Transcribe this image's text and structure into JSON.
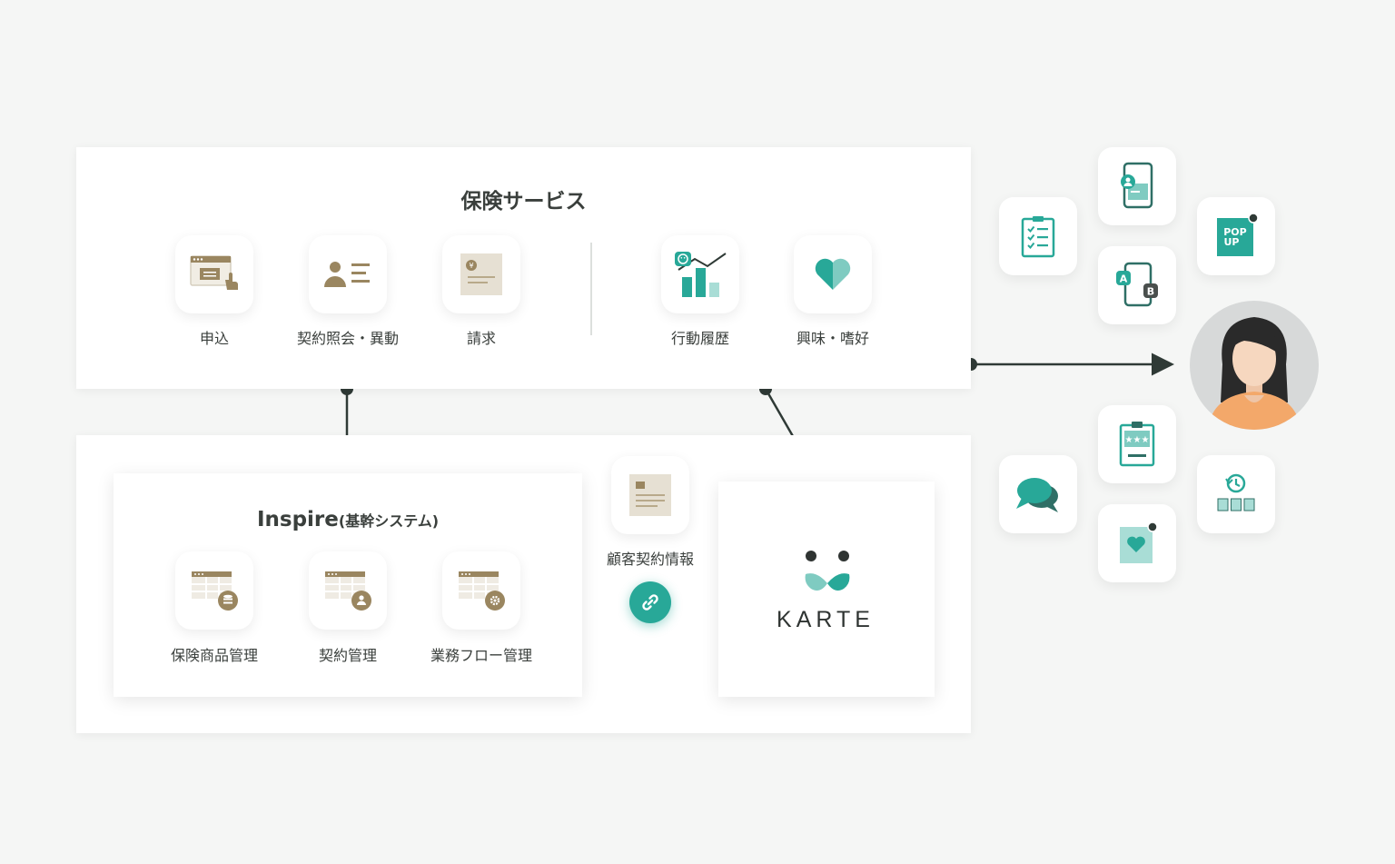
{
  "insurance_service": {
    "title": "保険サービス",
    "items": [
      {
        "label": "申込",
        "icon": "application-form-icon"
      },
      {
        "label": "契約照会・異動",
        "icon": "contract-inquiry-icon"
      },
      {
        "label": "請求",
        "icon": "billing-invoice-icon"
      },
      {
        "label": "行動履歴",
        "icon": "behavior-history-chart-icon"
      },
      {
        "label": "興味・嗜好",
        "icon": "interest-heart-icon"
      }
    ]
  },
  "inspire": {
    "title": "Inspire",
    "subtitle": "(基幹システム)",
    "items": [
      {
        "label": "保険商品管理",
        "icon": "product-management-icon"
      },
      {
        "label": "契約管理",
        "icon": "contract-management-icon"
      },
      {
        "label": "業務フロー管理",
        "icon": "workflow-management-icon"
      }
    ]
  },
  "customer_contract_info": {
    "label": "顧客契約情報",
    "icon": "customer-document-icon"
  },
  "link_icon": "link-chain-icon",
  "karte": {
    "logo_text": "KARTE"
  },
  "channels": [
    {
      "icon": "checklist-clipboard-icon",
      "text": ""
    },
    {
      "icon": "mobile-profile-icon",
      "text": ""
    },
    {
      "icon": "ab-test-mobile-icon",
      "text_a": "A",
      "text_b": "B"
    },
    {
      "icon": "popup-icon",
      "text_1": "POP",
      "text_2": "UP"
    },
    {
      "icon": "chat-bubbles-icon",
      "text": ""
    },
    {
      "icon": "rating-card-icon",
      "text": ""
    },
    {
      "icon": "favorite-notification-icon",
      "text": ""
    },
    {
      "icon": "history-recommend-icon",
      "text": ""
    }
  ],
  "colors": {
    "teal": "#28a898",
    "teal_light": "#7fcbc1",
    "brown": "#9a8660",
    "beige": "#e6e0d3",
    "line": "#2f3a36",
    "skin": "#f6d7bf",
    "hair": "#2a2a2a",
    "shirt": "#f3a86a"
  }
}
